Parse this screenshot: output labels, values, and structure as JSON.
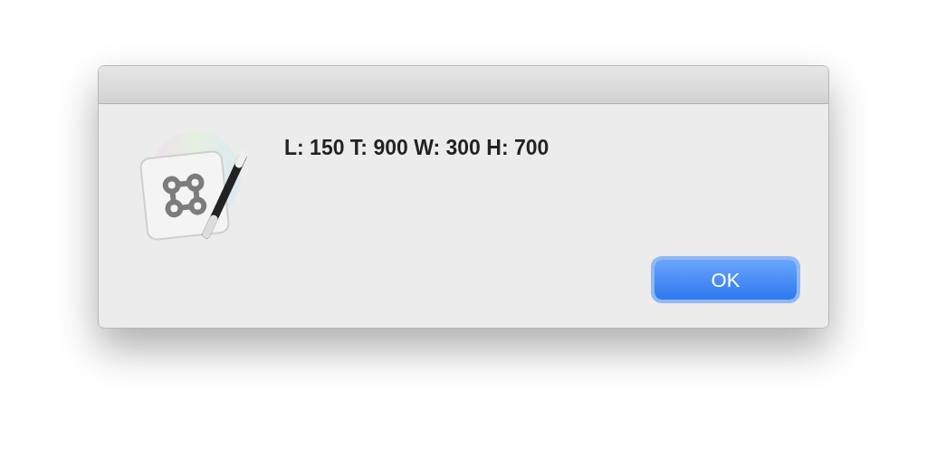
{
  "dialog": {
    "message": "L: 150 T: 900 W: 300 H: 700",
    "buttons": [
      {
        "label": "OK",
        "default": true
      }
    ]
  }
}
